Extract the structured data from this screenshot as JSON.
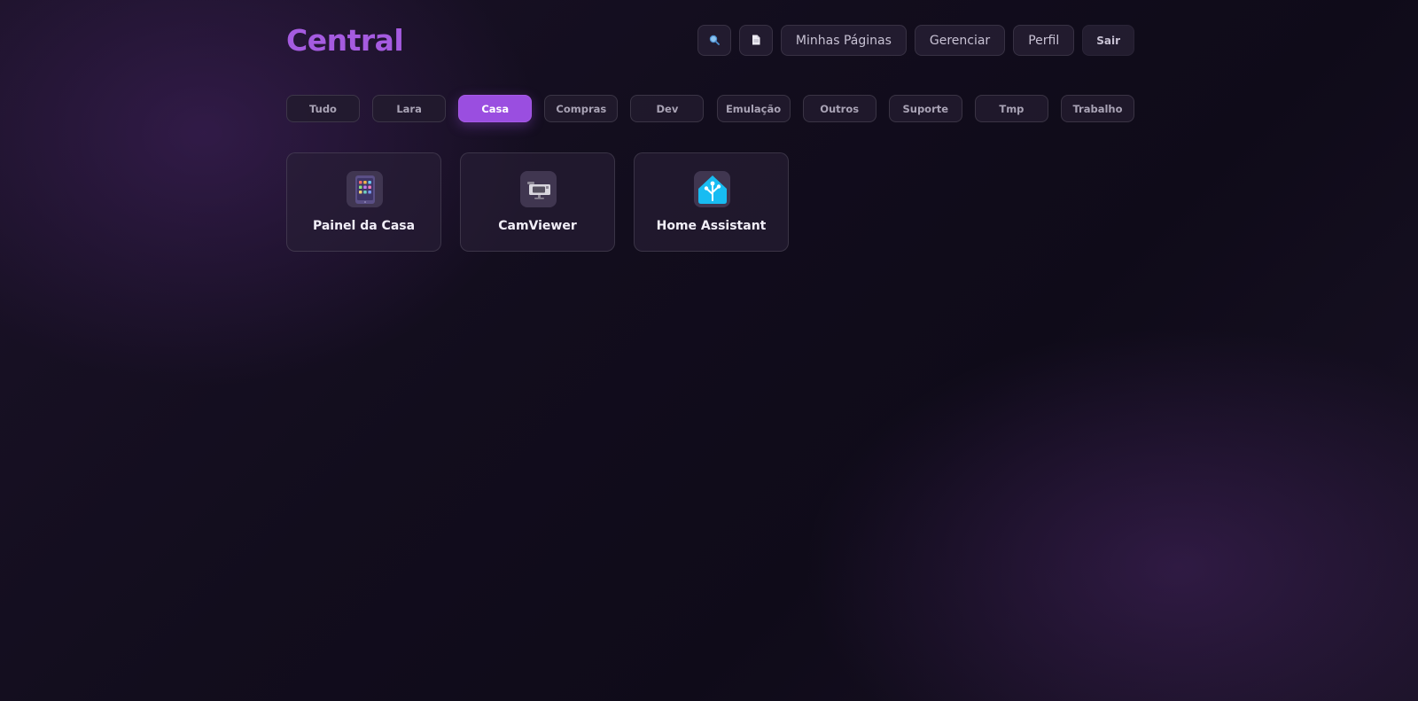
{
  "header": {
    "logo": "Central",
    "nav": {
      "search_icon": "search-icon",
      "document_icon": "document-icon",
      "my_pages": "Minhas Páginas",
      "manage": "Gerenciar",
      "profile": "Perfil",
      "logout": "Sair"
    }
  },
  "tabs": [
    {
      "label": "Tudo",
      "active": false
    },
    {
      "label": "Lara",
      "active": false
    },
    {
      "label": "Casa",
      "active": true
    },
    {
      "label": "Compras",
      "active": false
    },
    {
      "label": "Dev",
      "active": false
    },
    {
      "label": "Emulação",
      "active": false
    },
    {
      "label": "Outros",
      "active": false
    },
    {
      "label": "Suporte",
      "active": false
    },
    {
      "label": "Tmp",
      "active": false
    },
    {
      "label": "Trabalho",
      "active": false
    }
  ],
  "apps": [
    {
      "label": "Painel da Casa",
      "icon": "tablet-icon"
    },
    {
      "label": "CamViewer",
      "icon": "camera-icon"
    },
    {
      "label": "Home Assistant",
      "icon": "home-assistant-icon"
    }
  ],
  "colors": {
    "accent": "#a55be0",
    "active_tab": "#9a4ee0",
    "background": "#120d1d"
  }
}
